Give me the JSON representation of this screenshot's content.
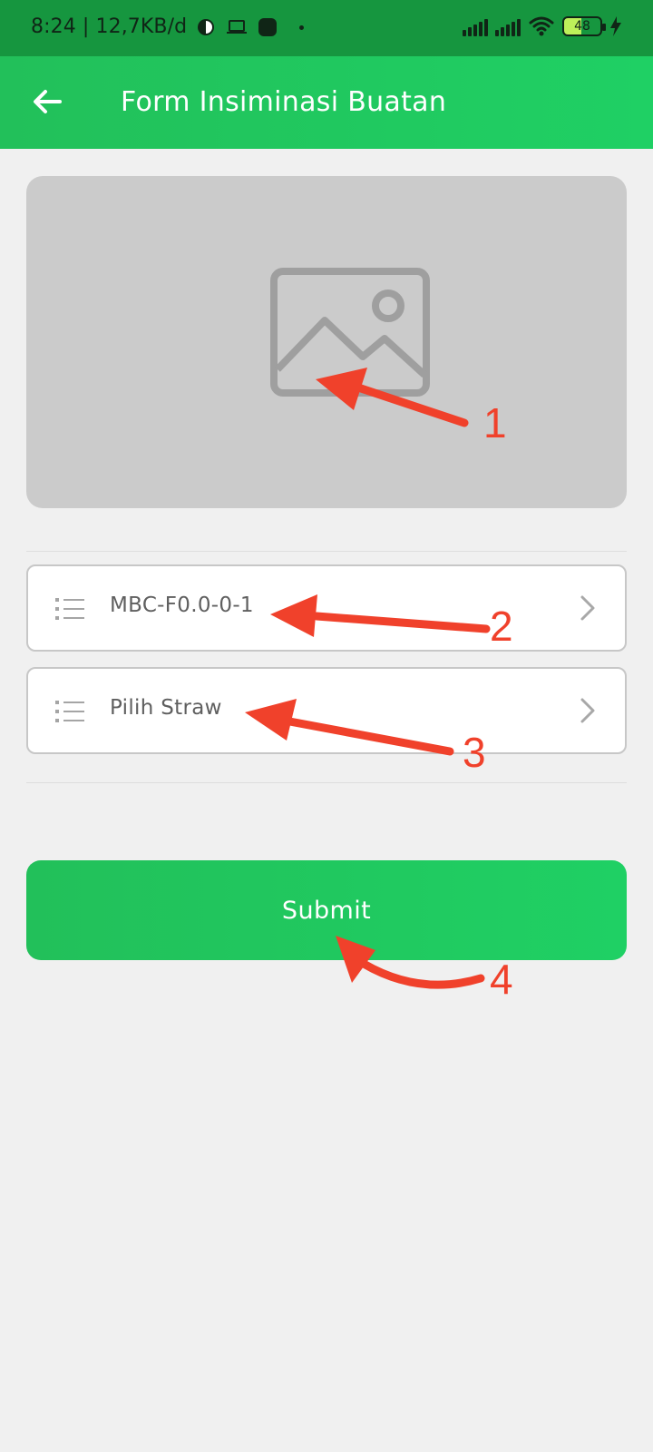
{
  "status_bar": {
    "time_and_speed": "8:24 | 12,7KB/d",
    "battery_level": "48",
    "icons": [
      "circle-status-icon",
      "laptop-icon",
      "app-status-icon",
      "dot-icon",
      "signal-icon",
      "signal-icon",
      "wifi-icon",
      "battery-icon",
      "charging-icon"
    ]
  },
  "app_bar": {
    "title": "Form Insiminasi Buatan",
    "back_icon": "arrow-left-icon",
    "background": "#1fd064"
  },
  "image_picker": {
    "icon": "image-placeholder-icon",
    "background": "#cbcbcb"
  },
  "fields": [
    {
      "icon": "list-icon",
      "label": "MBC-F0.0-0-1",
      "chevron_icon": "chevron-right-icon"
    },
    {
      "icon": "list-icon",
      "label": "Pilih Straw",
      "chevron_icon": "chevron-right-icon"
    }
  ],
  "submit": {
    "label": "Submit"
  },
  "annotations": {
    "numbers": [
      "1",
      "2",
      "3",
      "4"
    ],
    "color": "#f0412b"
  },
  "colors": {
    "brand_green": "#1fd064",
    "status_bar_green": "#16963f",
    "page_background": "#f0f0f0"
  }
}
